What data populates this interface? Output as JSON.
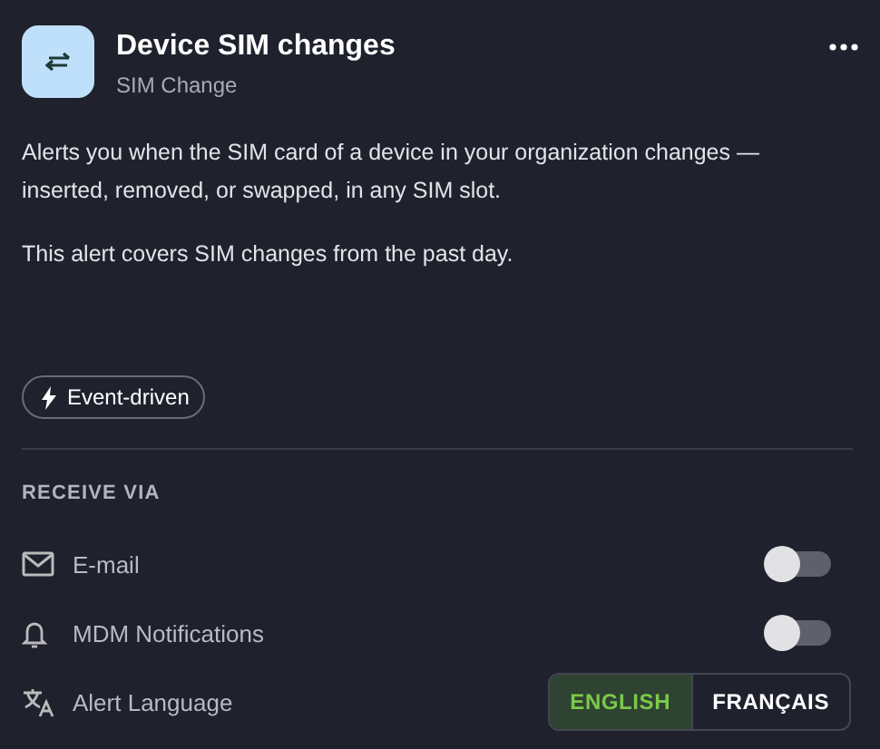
{
  "header": {
    "title": "Device SIM changes",
    "subtitle": "SIM Change"
  },
  "description": [
    "Alerts you when the SIM card of a device in your organization changes — inserted, removed, or swapped, in any SIM slot.",
    "This alert covers SIM changes from the past day."
  ],
  "chip": {
    "label": "Event-driven"
  },
  "section": {
    "title": "RECEIVE VIA"
  },
  "rows": [
    {
      "kind": "toggle",
      "label": "E-mail",
      "on": false
    },
    {
      "kind": "toggle",
      "label": "MDM Notifications",
      "on": false
    },
    {
      "kind": "segmented",
      "label": "Alert Language",
      "options": [
        {
          "label": "ENGLISH",
          "selected": true
        },
        {
          "label": "FRANÇAIS",
          "selected": false
        }
      ]
    }
  ]
}
